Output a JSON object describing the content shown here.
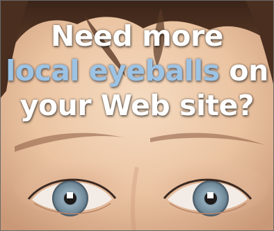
{
  "ad": {
    "headline": {
      "line1": "Need more",
      "line2_highlight": "local eyeballs",
      "line2_rest": " on",
      "line3": "your Web site?"
    },
    "colors": {
      "headline_white": "#ffffff",
      "headline_blue": "#9cc3e4",
      "iris": "#8fa8b8"
    },
    "image_subject": "close-up of a woman's face showing forehead and eyes"
  }
}
